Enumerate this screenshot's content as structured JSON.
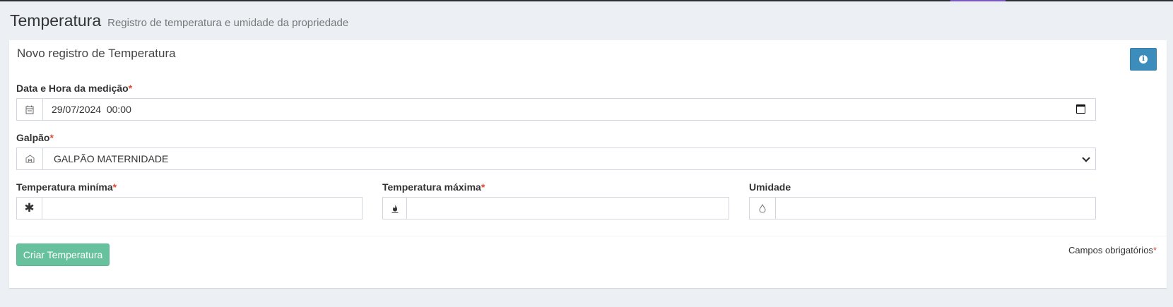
{
  "header": {
    "title": "Temperatura",
    "subtitle": "Registro de temperatura e umidade da propriedade"
  },
  "form": {
    "box_title": "Novo registro de Temperatura",
    "info_icon": "info-icon",
    "datetime": {
      "label": "Data e Hora da medição",
      "required_mark": "*",
      "value": "29/07/2024  00:00",
      "icon": "calendar-icon"
    },
    "galpao": {
      "label": "Galpão",
      "required_mark": "*",
      "selected": "GALPÃO MATERNIDADE",
      "icon": "building-icon"
    },
    "temp_min": {
      "label": "Temperatura miníma",
      "required_mark": "*",
      "value": "",
      "icon": "snowflake-icon"
    },
    "temp_max": {
      "label": "Temperatura máxima",
      "required_mark": "*",
      "value": "",
      "icon": "fire-icon"
    },
    "umidade": {
      "label": "Umidade",
      "value": "",
      "icon": "droplet-icon"
    },
    "submit_label": "Criar Temperatura",
    "required_note": "Campos obrigatórios",
    "required_note_mark": "*"
  },
  "colors": {
    "primary_button": "#3c8dbc",
    "success_button": "#68c19d",
    "required": "#dd4b39",
    "background": "#ecf0f5",
    "topbar_accent": "#7e57c2"
  }
}
